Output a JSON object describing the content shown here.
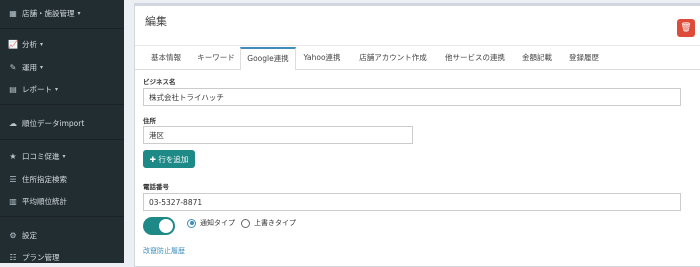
{
  "sidebar": {
    "items": [
      {
        "icon": "store-icon",
        "glyph": "▦",
        "label": "店舗・施設管理",
        "caret": "▾"
      },
      {
        "icon": "chart-icon",
        "glyph": "📈",
        "label": "分析",
        "caret": "▾"
      },
      {
        "icon": "wrench-icon",
        "glyph": "✎",
        "label": "運用",
        "caret": "▾"
      },
      {
        "icon": "report-icon",
        "glyph": "▤",
        "label": "レポート",
        "caret": "▾"
      },
      {
        "icon": "cloud-upload-icon",
        "glyph": "☁",
        "label": "順位データimport",
        "caret": ""
      },
      {
        "icon": "star-icon",
        "glyph": "★",
        "label": "口コミ促進",
        "caret": "▾"
      },
      {
        "icon": "list-icon",
        "glyph": "☰",
        "label": "住所指定検索",
        "caret": ""
      },
      {
        "icon": "table-icon",
        "glyph": "▥",
        "label": "平均順位統計",
        "caret": ""
      },
      {
        "icon": "gear-icon",
        "glyph": "⚙",
        "label": "設定",
        "caret": ""
      },
      {
        "icon": "plan-icon",
        "glyph": "☷",
        "label": "プラン管理",
        "caret": ""
      }
    ]
  },
  "panel": {
    "title": "編集",
    "delete_icon": "trash-icon",
    "delete_glyph": "🗑"
  },
  "tabs": [
    "基本情報",
    "キーワード",
    "Google連携",
    "Yahoo連携",
    "店舗アカウント作成",
    "他サービスの連携",
    "金額記載",
    "登録履歴"
  ],
  "active_tab": "Google連携",
  "form": {
    "business_name_label": "ビジネス名",
    "business_name_value": "株式会社トライハッチ",
    "address_label": "住所",
    "address_value": "港区",
    "add_row_label": "✚ 行を追加",
    "phone_label": "電話番号",
    "phone_value": "03-5327-8871",
    "radio_notify": "通知タイプ",
    "radio_overwrite": "上書きタイプ",
    "selected_radio": "通知タイプ",
    "toggle_on": true,
    "history_link": "改竄防止履歴"
  }
}
